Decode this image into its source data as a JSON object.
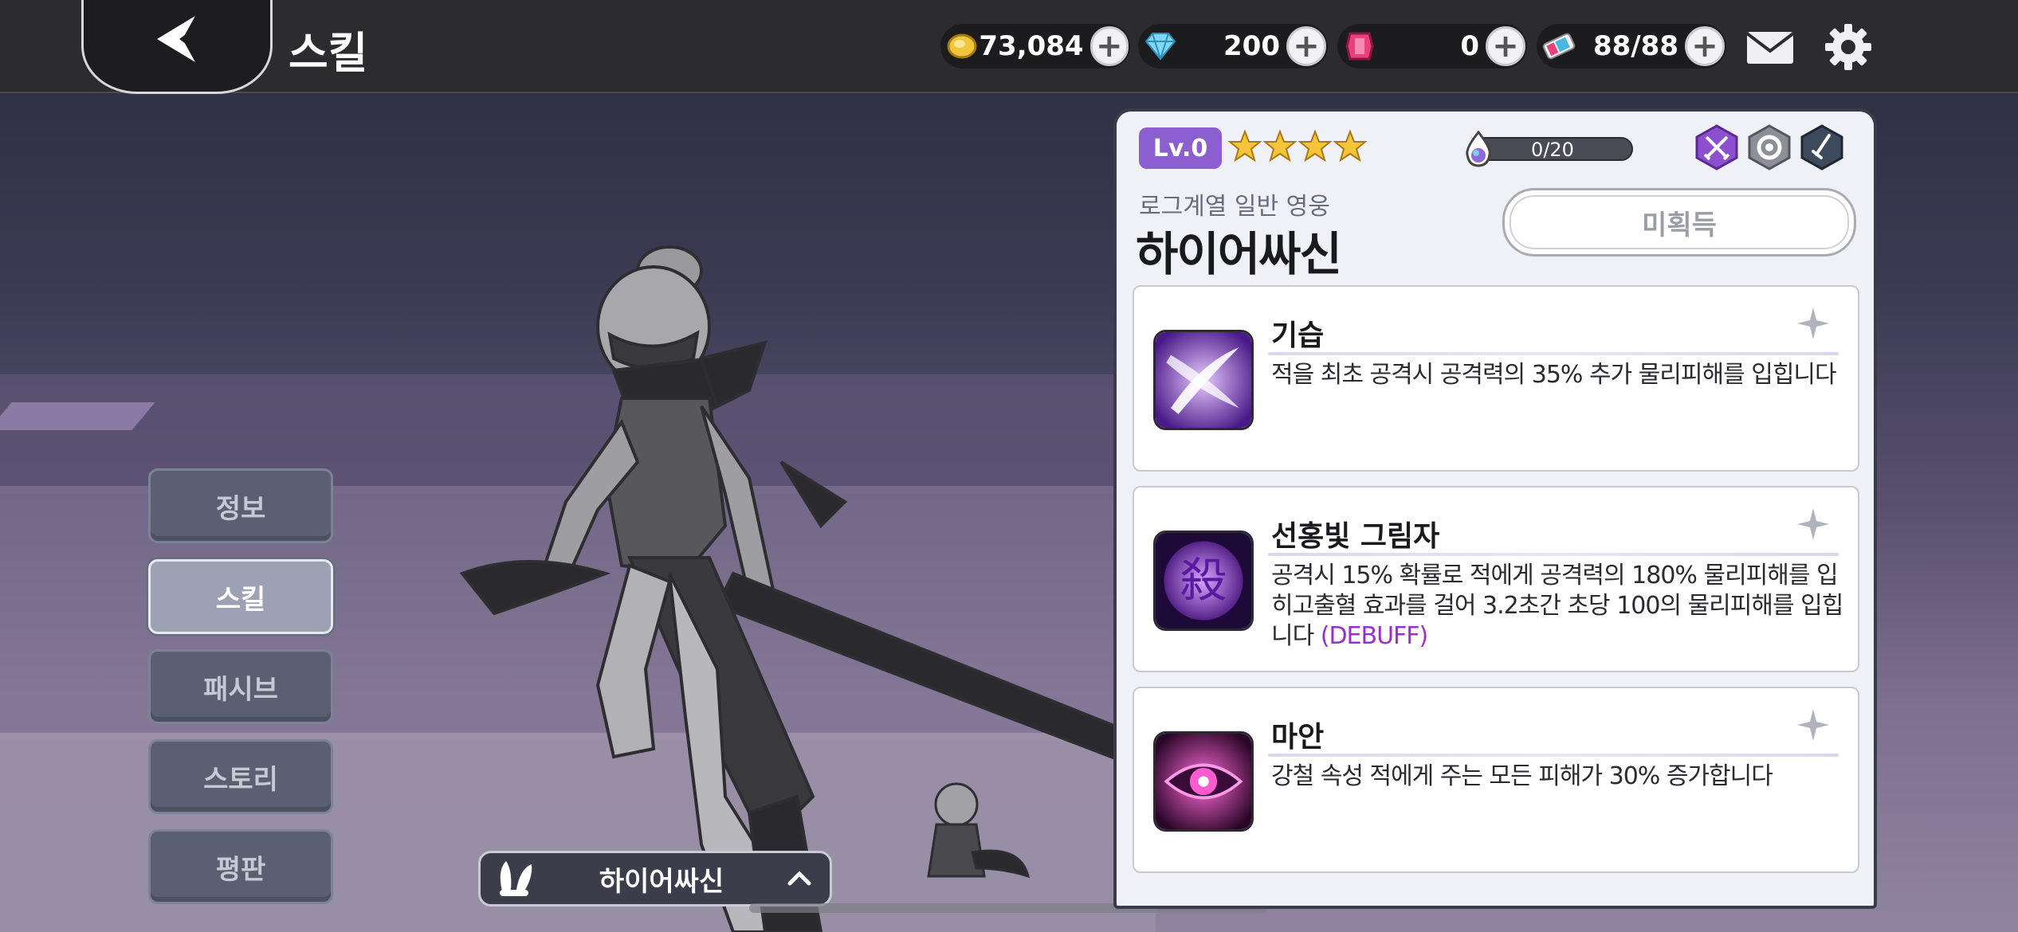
{
  "header": {
    "title": "스킬",
    "back_icon": "back-arrow-icon"
  },
  "resources": [
    {
      "icon": "gold-coin-icon",
      "value": "73,084"
    },
    {
      "icon": "diamond-icon",
      "value": "200"
    },
    {
      "icon": "ruby-gem-icon",
      "value": "0"
    },
    {
      "icon": "stamina-ticket-icon",
      "value": "88/88"
    }
  ],
  "nav": {
    "items": [
      {
        "label": "정보"
      },
      {
        "label": "스킬"
      },
      {
        "label": "패시브"
      },
      {
        "label": "스토리"
      },
      {
        "label": "평판"
      }
    ],
    "active_index": 1
  },
  "hero_selector": {
    "name": "하이어싸신"
  },
  "panel": {
    "level": "Lv.0",
    "stars": 4,
    "exp_text": "0/20",
    "class_label": "로그계열 일반 영웅",
    "hero_name": "하이어싸신",
    "status_button": "미획득",
    "skills": [
      {
        "name": "기습",
        "description": "적을 최초 공격시 공격력의 35% 추가 물리피해를 입힙니다",
        "tag": "",
        "icon": "slash-skill-icon"
      },
      {
        "name": "선홍빛 그림자",
        "description": "공격시 15% 확률로 적에게 공격력의 180% 물리피해를 입히고출혈 효과를 걸어 3.2초간 초당 100의 물리피해를 입힙니다",
        "tag": "(DEBUFF)",
        "icon": "kill-kanji-skill-icon"
      },
      {
        "name": "마안",
        "description": "강철 속성 적에게 주는 모든 피해가 30% 증가합니다",
        "tag": "",
        "icon": "demon-eye-skill-icon"
      }
    ]
  },
  "colors": {
    "accent": "#8c5fd0",
    "debuff": "#9a2fd0",
    "topbar": "#2c2c2f"
  }
}
